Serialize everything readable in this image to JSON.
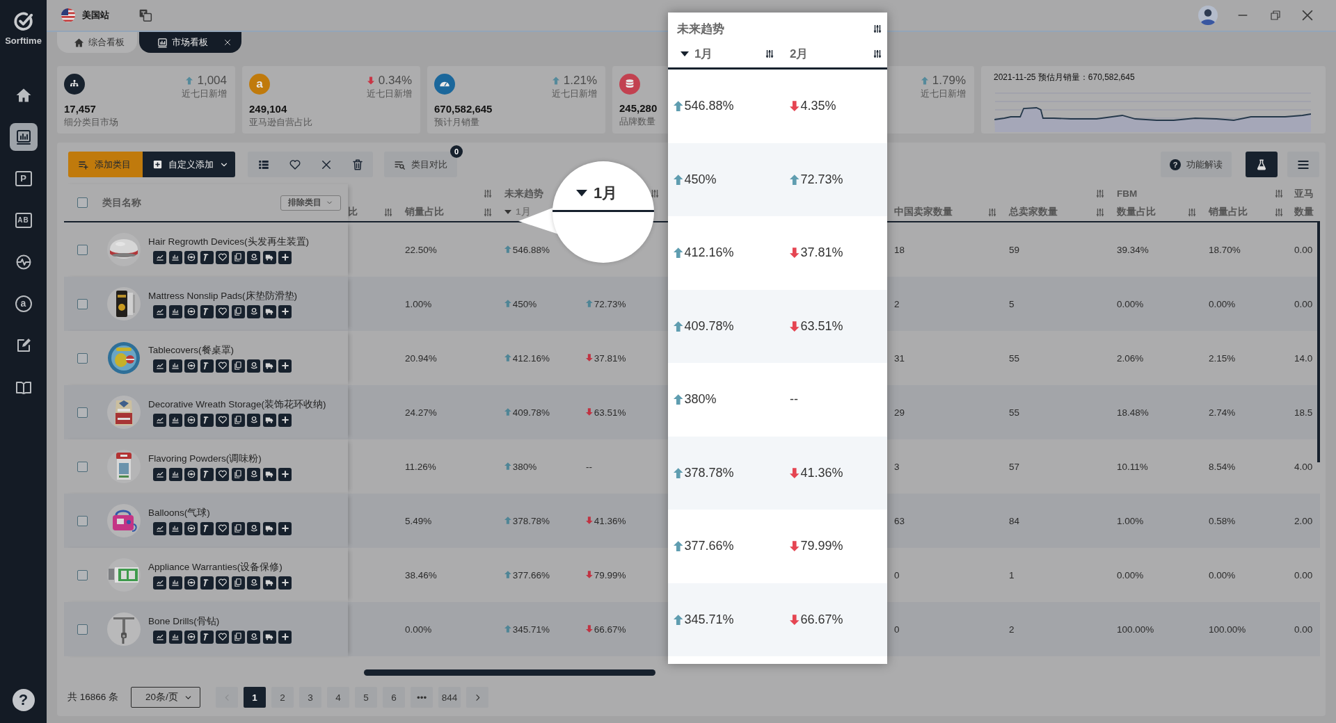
{
  "sidebar": {
    "logo_text": "Sorftime",
    "items": [
      {
        "kind": "home",
        "selected": false
      },
      {
        "kind": "chart",
        "selected": true
      },
      {
        "kind": "letter-box",
        "glyph": "P",
        "selected": false
      },
      {
        "kind": "split-box",
        "glyph": "AB",
        "selected": false
      },
      {
        "kind": "pulse",
        "selected": false
      },
      {
        "kind": "letter-circle",
        "glyph": "a",
        "selected": false
      },
      {
        "kind": "edit",
        "selected": false
      },
      {
        "kind": "book",
        "selected": false
      }
    ],
    "help_glyph": "?"
  },
  "topbar": {
    "site": "美国站"
  },
  "tabs": [
    {
      "label": "综合看板",
      "kind": "home",
      "selected": false,
      "closable": false
    },
    {
      "label": "市场看板",
      "kind": "chart",
      "selected": true,
      "closable": true
    }
  ],
  "stats": [
    {
      "kind": "sitemap",
      "color": "#17212d",
      "up": true,
      "delta": "1,004",
      "delta_label": "近七日新增",
      "value": "17,457",
      "label": "细分类目市场"
    },
    {
      "kind": "letter",
      "glyph": "a",
      "color": "#c07a0c",
      "up": false,
      "delta": "0.34%",
      "delta_label": "近七日新增",
      "value": "249,104",
      "label": "亚马逊自营占比"
    },
    {
      "kind": "gauge",
      "color": "#1b679b",
      "up": true,
      "delta": "1.21%",
      "delta_label": "近七日新增",
      "value": "670,582,645",
      "label": "预计月销量"
    },
    {
      "kind": "database",
      "color": "#c24150",
      "value": "245,280",
      "label": "品牌数量"
    },
    {
      "up": true,
      "delta": "1.79%",
      "delta_label": "近七日新增"
    }
  ],
  "sales_chart": {
    "title": "2021-11-25 预估月销量：670,582,645"
  },
  "toolbar": {
    "add": "添加类目",
    "custom_add": "自定义添加",
    "compare": "类目对比",
    "compare_count": "0",
    "help": "功能解读",
    "help_glyph": "?"
  },
  "table": {
    "select_all_checked": false,
    "name_header": "类目名称",
    "exclude_filter": "排除类目",
    "groups": [
      {
        "sort_icon": true
      },
      {
        "label": "未来趋势",
        "sort_icon": true
      },
      {
        "sort_icon": true
      },
      {
        "label": "FBM",
        "sort_icon": true
      },
      {
        "label": "亚马",
        "sort_icon": false
      }
    ],
    "columns": [
      {
        "label": "比",
        "sorted": false,
        "sort_icon": true
      },
      {
        "label": "销量占比",
        "sorted": false,
        "sort_icon": true
      },
      {
        "label": "1月",
        "sorted": true,
        "sort_icon": false
      },
      null,
      {
        "label": "中国卖家数量",
        "sorted": false,
        "sort_icon": true
      },
      {
        "label": "总卖家数量",
        "sorted": false,
        "sort_icon": true
      },
      {
        "label": "数量占比",
        "sorted": false,
        "sort_icon": true
      },
      {
        "label": "销量占比",
        "sorted": false,
        "sort_icon": true
      },
      {
        "label": "数量",
        "sorted": false,
        "sort_icon": false
      }
    ],
    "rows": [
      {
        "name": "Hair Regrowth Devices(头发再生装置)",
        "checked": false,
        "cells": [
          null,
          "22.50%",
          {
            "value": "546.88%",
            "up": true
          },
          null,
          "18",
          "59",
          "39.34%",
          "18.70%",
          "0.00"
        ]
      },
      {
        "name": "Mattress Nonslip Pads(床垫防滑垫)",
        "checked": false,
        "cells": [
          null,
          "1.00%",
          {
            "value": "450%",
            "up": true
          },
          {
            "value": "72.73%",
            "up": true
          },
          "2",
          "5",
          "0.00%",
          "0.00%",
          "0.00"
        ]
      },
      {
        "name": "Tablecovers(餐桌罩)",
        "checked": false,
        "cells": [
          null,
          "20.94%",
          {
            "value": "412.16%",
            "up": true
          },
          {
            "value": "37.81%",
            "up": false
          },
          "31",
          "55",
          "2.06%",
          "2.15%",
          "14.0"
        ]
      },
      {
        "name": "Decorative Wreath Storage(装饰花环收纳)",
        "checked": false,
        "cells": [
          null,
          "24.27%",
          {
            "value": "409.78%",
            "up": true
          },
          {
            "value": "63.51%",
            "up": false
          },
          "29",
          "55",
          "18.48%",
          "2.74%",
          "18.5"
        ]
      },
      {
        "name": "Flavoring Powders(调味粉)",
        "checked": false,
        "cells": [
          null,
          "11.26%",
          {
            "value": "380%",
            "up": true
          },
          {
            "value": "--"
          },
          "3",
          "57",
          "10.11%",
          "8.54%",
          "4.00"
        ]
      },
      {
        "name": "Balloons(气球)",
        "checked": false,
        "cells": [
          null,
          "5.49%",
          {
            "value": "378.78%",
            "up": true
          },
          {
            "value": "41.36%",
            "up": false
          },
          "63",
          "84",
          "1.00%",
          "0.58%",
          "2.00"
        ]
      },
      {
        "name": "Appliance Warranties(设备保修)",
        "checked": false,
        "cells": [
          null,
          "38.46%",
          {
            "value": "377.66%",
            "up": true
          },
          {
            "value": "79.99%",
            "up": false
          },
          "0",
          "1",
          "0.00%",
          "0.00%",
          "0.00"
        ]
      },
      {
        "name": "Bone Drills(骨钻)",
        "checked": false,
        "cells": [
          null,
          "0.00%",
          {
            "value": "345.71%",
            "up": true
          },
          {
            "value": "66.67%",
            "up": false
          },
          "0",
          "2",
          "100.00%",
          "100.00%",
          "0.00"
        ]
      }
    ]
  },
  "popup": {
    "title": "未来趋势",
    "columns": [
      {
        "label": "1月",
        "sorted": true
      },
      {
        "label": "2月",
        "sorted": false
      }
    ],
    "rows": [
      {
        "cells": [
          {
            "value": "546.88%",
            "up": true
          },
          {
            "value": "4.35%",
            "up": false
          }
        ]
      },
      {
        "cells": [
          {
            "value": "450%",
            "up": true
          },
          {
            "value": "72.73%",
            "up": true
          }
        ]
      },
      {
        "cells": [
          {
            "value": "412.16%",
            "up": true
          },
          {
            "value": "37.81%",
            "up": false
          }
        ]
      },
      {
        "cells": [
          {
            "value": "409.78%",
            "up": true
          },
          {
            "value": "63.51%",
            "up": false
          }
        ]
      },
      {
        "cells": [
          {
            "value": "380%",
            "up": true
          },
          {
            "value": "--"
          }
        ]
      },
      {
        "cells": [
          {
            "value": "378.78%",
            "up": true
          },
          {
            "value": "41.36%",
            "up": false
          }
        ]
      },
      {
        "cells": [
          {
            "value": "377.66%",
            "up": true
          },
          {
            "value": "79.99%",
            "up": false
          }
        ]
      },
      {
        "cells": [
          {
            "value": "345.71%",
            "up": true
          },
          {
            "value": "66.67%",
            "up": false
          }
        ]
      }
    ]
  },
  "lens": {
    "label": "1月",
    "sorted": true
  },
  "pagination": {
    "total": "共 16866 条",
    "page_size": "20条/页",
    "prev_disabled": true,
    "pages": [
      {
        "label": "1",
        "selected": true
      },
      {
        "label": "2",
        "selected": false
      },
      {
        "label": "3",
        "selected": false
      },
      {
        "label": "4",
        "selected": false
      },
      {
        "label": "5",
        "selected": false
      },
      {
        "label": "6",
        "selected": false
      },
      {
        "label": "•••",
        "selected": false
      },
      {
        "label": "844",
        "selected": false
      }
    ]
  }
}
